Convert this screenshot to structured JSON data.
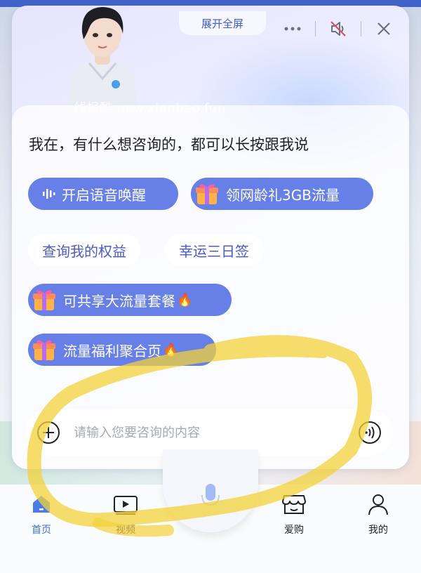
{
  "panel": {
    "expand_label": "展开全屏",
    "watermark": "线报酷 new.xianbao.fun",
    "prompt": "我在，有什么想咨询的，都可以长按跟我说"
  },
  "chips": {
    "voice_wake": "开启语音唤醒",
    "net_age_gift": "领网龄礼3GB流量",
    "my_benefits": "查询我的权益",
    "lucky_checkin": "幸运三日签",
    "shared_plan": "可共享大流量套餐",
    "data_welfare": "流量福利聚合页"
  },
  "input": {
    "placeholder": "请输入您要咨询的内容"
  },
  "nav": {
    "home": "首页",
    "video": "视频",
    "shop": "爱购",
    "mine": "我的"
  },
  "colors": {
    "accent": "#3b6fe0",
    "chip_blue": "#6680e8",
    "highlight": "#f3d23a"
  },
  "icons": [
    "more-icon",
    "mute-icon",
    "close-icon",
    "voice-wave-icon",
    "gift-icon",
    "fire-icon",
    "plus-icon",
    "voice-input-icon",
    "home-icon",
    "video-icon",
    "shop-icon",
    "user-icon",
    "microphone-icon"
  ]
}
